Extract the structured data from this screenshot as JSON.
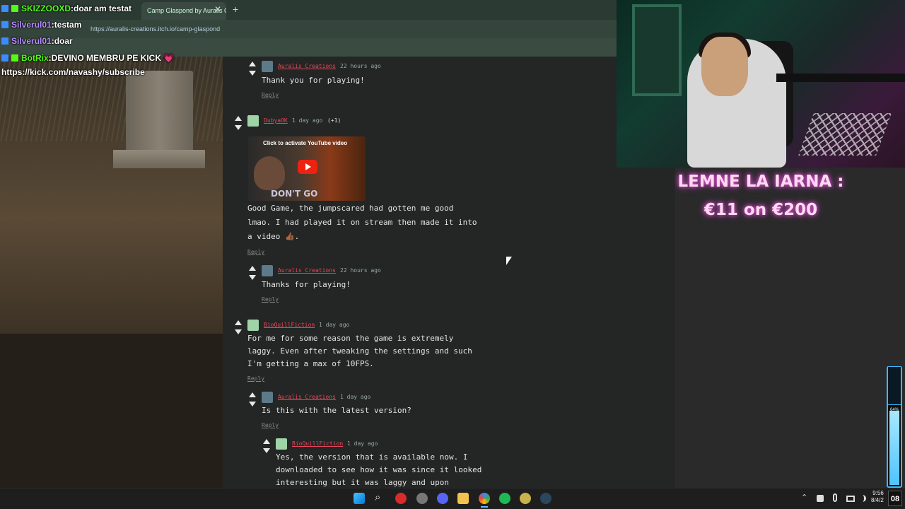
{
  "browser": {
    "tab_title": "Camp Glaspond by Auralis Cre",
    "tab_close": "✕",
    "new_tab": "+",
    "url": "https://auralis-creations.itch.io/camp-glaspond"
  },
  "chat": [
    {
      "user": "SKIZZOOXD",
      "sep": " : ",
      "message": "doar am testat"
    },
    {
      "user": "Silverul01",
      "sep": " : ",
      "message": "testam"
    },
    {
      "user": "Silverul01",
      "sep": " : ",
      "message": "doar"
    },
    {
      "user": "BotRix",
      "sep": " : ",
      "message": "DEVINO MEMBRU PE KICK",
      "heart": "💗"
    },
    {
      "message": "https://kick.com/navashy/subscribe"
    }
  ],
  "comments": [
    {
      "author": "Auralis Creations",
      "time": "22 hours ago",
      "lines": [
        "Thank you for playing!"
      ],
      "reply": "Reply"
    },
    {
      "author": "DubyaOK",
      "time": "1 day ago",
      "extra": "(+1)",
      "lines": [
        "Good Game, the jumpscared had gotten me good",
        "lmao. I had played it on stream then made it into",
        "a video 👍🏾."
      ],
      "reply": "Reply"
    },
    {
      "author": "Auralis Creations",
      "time": "22 hours ago",
      "lines": [
        "Thanks for playing!"
      ],
      "reply": "Reply"
    },
    {
      "author": "BioQuillFiction",
      "time": "1 day ago",
      "lines": [
        "For me for some reason the game is extremely",
        "laggy. Even after tweaking the settings and such",
        "I'm getting a max of 10FPS."
      ],
      "reply": "Reply"
    },
    {
      "author": "Auralis Creations",
      "time": "1 day ago",
      "lines": [
        "Is this with the latest version?"
      ],
      "reply": "Reply"
    },
    {
      "author": "BioQuillFiction",
      "time": "1 day ago",
      "lines": [
        "Yes, the version that is available now. I",
        "downloaded to see how it was since it looked",
        "interesting but it was laggy and upon"
      ]
    }
  ],
  "youtube": {
    "activate_label": "Click to activate YouTube video",
    "video_text": "DON'T GO"
  },
  "overlay": {
    "goal_title": "LEMNE LA IARNA :",
    "goal_value": "€11 on €200",
    "battery_label": "64%",
    "battery_level": 0.64
  },
  "taskbar": {
    "search_icon": "⌕",
    "tray_chevron": "⌃",
    "clock_time": "9:56",
    "clock_date": "8/4/2",
    "corner_badge": "08"
  }
}
